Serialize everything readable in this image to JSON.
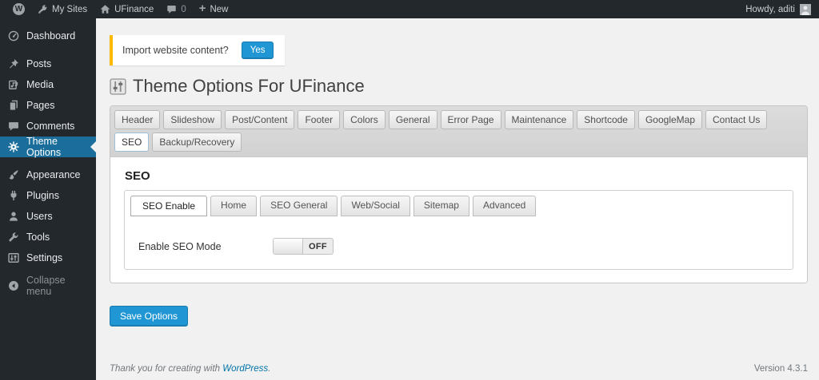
{
  "colors": {
    "accent_blue": "#2196d4",
    "active_menu_blue": "#1b6e9c",
    "notice_yellow": "#ffb900",
    "link_blue": "#0073aa",
    "admin_bar_bg": "#23282d"
  },
  "admin_bar": {
    "wp_logo_glyph": "W",
    "my_sites_label": "My Sites",
    "site_name": "UFinance",
    "comment_count": "0",
    "plus_glyph": "+",
    "new_label": "New",
    "howdy_text": "Howdy, aditi"
  },
  "sidebar": {
    "items": [
      {
        "label": "Dashboard"
      },
      {
        "label": "Posts"
      },
      {
        "label": "Media"
      },
      {
        "label": "Pages"
      },
      {
        "label": "Comments"
      },
      {
        "label": "Theme Options"
      },
      {
        "label": "Appearance"
      },
      {
        "label": "Plugins"
      },
      {
        "label": "Users"
      },
      {
        "label": "Tools"
      },
      {
        "label": "Settings"
      },
      {
        "label": "Collapse menu"
      }
    ]
  },
  "notice": {
    "text": "Import website content?",
    "yes_button": "Yes"
  },
  "page": {
    "title": "Theme Options For UFinance"
  },
  "theme_tabs": {
    "row1": [
      "Header",
      "Slideshow",
      "Post/Content",
      "Footer",
      "Colors",
      "General",
      "Error Page",
      "Maintenance",
      "Shortcode",
      "GoogleMap",
      "Contact Us"
    ],
    "row2": [
      "SEO",
      "Backup/Recovery"
    ],
    "active_tab": "SEO"
  },
  "seo_panel": {
    "heading": "SEO",
    "subtabs": [
      "SEO Enable",
      "Home",
      "SEO General",
      "Web/Social",
      "Sitemap",
      "Advanced"
    ],
    "active_subtab": "SEO Enable",
    "field_label": "Enable SEO Mode",
    "toggle_state": "OFF"
  },
  "actions": {
    "save_button": "Save Options"
  },
  "footer": {
    "thanks_text": "Thank you for creating with",
    "wordpress_link": "WordPress",
    "period": ".",
    "version": "Version 4.3.1"
  }
}
